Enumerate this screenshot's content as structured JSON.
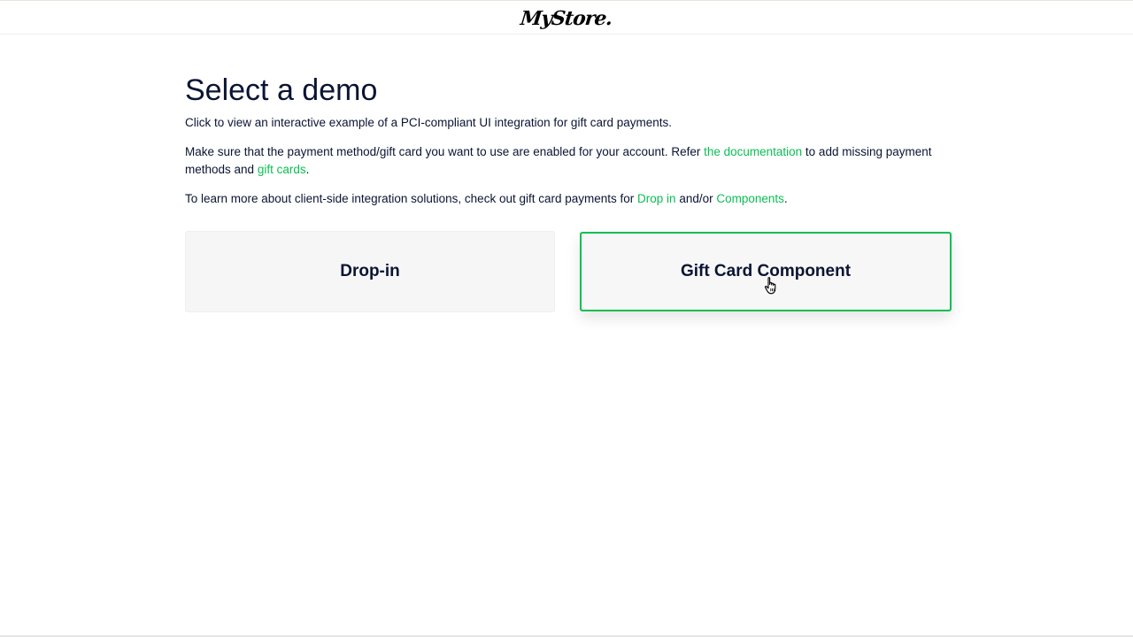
{
  "header": {
    "logo_text": "MyStore."
  },
  "main": {
    "title": "Select a demo",
    "intro": "Click to view an interactive example of a PCI-compliant UI integration for gift card payments.",
    "paragraph2": {
      "before": "Make sure that the payment method/gift card you want to use are enabled for your account. Refer ",
      "link1": "the documentation",
      "middle": " to add missing payment methods and ",
      "link2": "gift cards",
      "after": "."
    },
    "paragraph3": {
      "before": "To learn more about client-side integration solutions, check out gift card payments for ",
      "link1": "Drop in",
      "middle": " and/or ",
      "link2": "Components",
      "after": "."
    }
  },
  "cards": [
    {
      "label": "Drop-in"
    },
    {
      "label": "Gift Card Component"
    }
  ],
  "colors": {
    "accent": "#0abf53",
    "text": "#0a1433"
  }
}
